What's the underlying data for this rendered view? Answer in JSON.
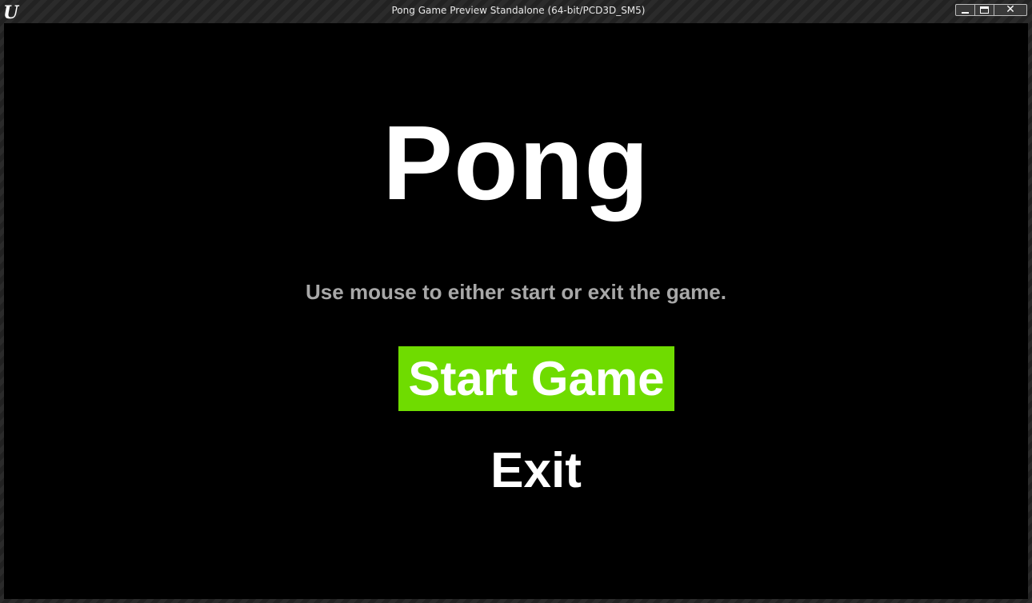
{
  "window": {
    "title": "Pong Game Preview Standalone (64-bit/PCD3D_SM5)",
    "logo_icon": "unreal-engine-logo-icon",
    "logo_glyph": "U",
    "controls": {
      "minimize_icon": "minimize-icon",
      "maximize_icon": "maximize-icon",
      "close_icon": "close-icon",
      "close_glyph": "✕"
    }
  },
  "menu": {
    "title": "Pong",
    "instructions": "Use mouse to either start or exit the game.",
    "start_button": "Start Game",
    "exit_button": "Exit"
  },
  "colors": {
    "viewport_background": "#000000",
    "start_button_highlight": "#6fdc00",
    "instructions_text": "#a8a8a8"
  }
}
